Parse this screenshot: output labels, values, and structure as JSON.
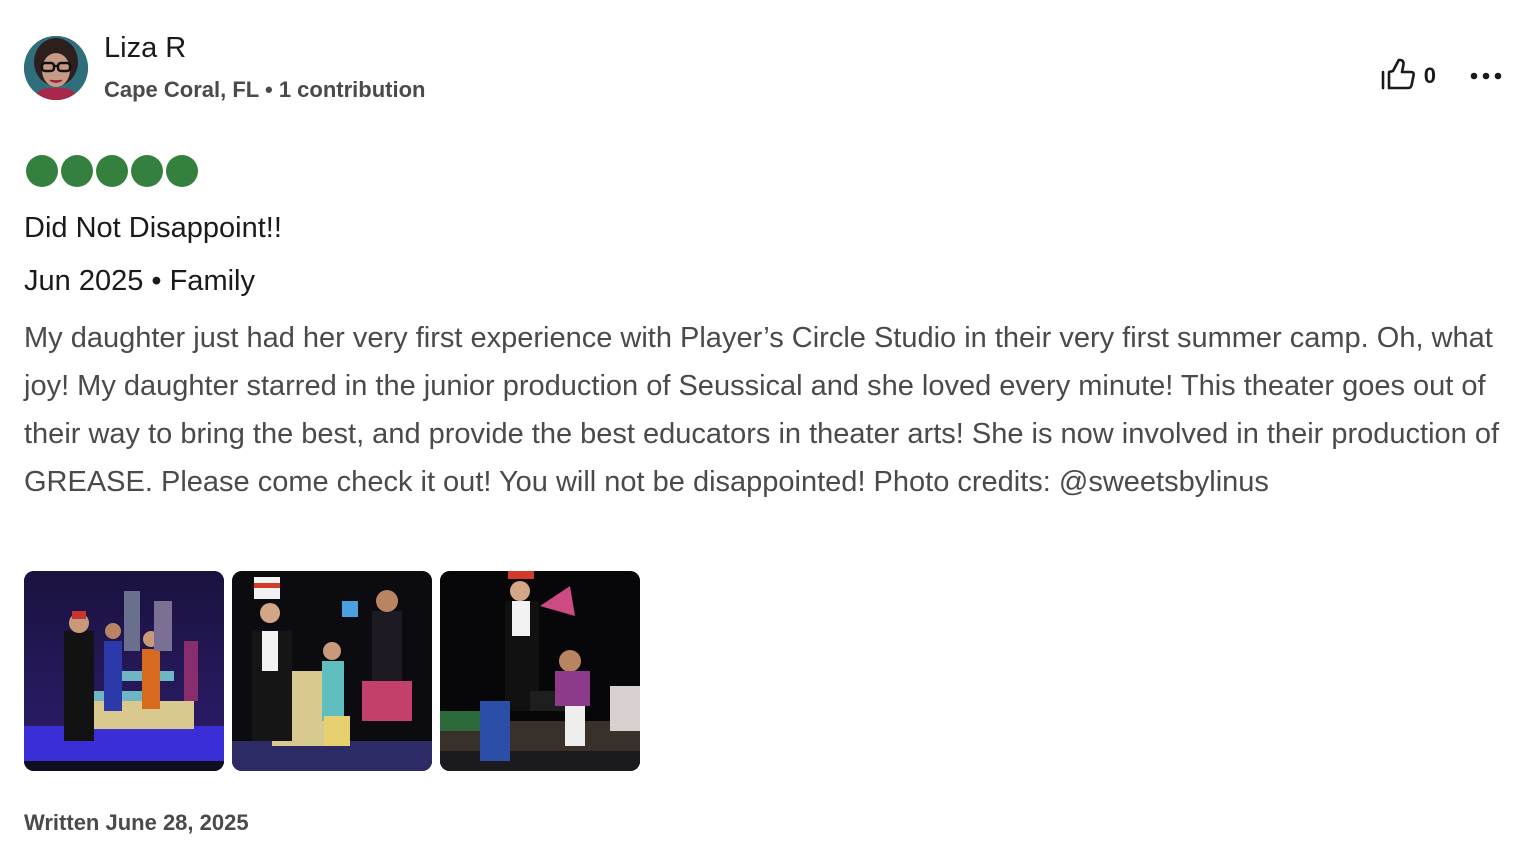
{
  "user": {
    "name": "Liza R",
    "location": "Cape Coral, FL",
    "separator": "•",
    "contributions": "1 contribution"
  },
  "actions": {
    "helpful_icon": "thumbs-up-icon",
    "helpful_count": "0",
    "more_icon": "more-options-icon"
  },
  "rating": {
    "value": 5,
    "max": 5,
    "color": "#34813f"
  },
  "review": {
    "title": "Did Not Disappoint!!",
    "trip_info": "Jun 2025 • Family",
    "body": "My daughter just had her very first experience with Player’s Circle Studio in their very first summer camp. Oh, what joy! My daughter starred in the junior production of Seussical and she loved every minute! This theater goes out of their way to bring the best, and provide the best educators in theater arts! She is now involved in their production of GREASE. Please come check it out! You will not be disappointed! Photo credits: @sweetsbylinus",
    "written": "Written June 28, 2025"
  },
  "photos": [
    {
      "icon": "stage-photo-1"
    },
    {
      "icon": "stage-photo-2"
    },
    {
      "icon": "stage-photo-3"
    }
  ]
}
